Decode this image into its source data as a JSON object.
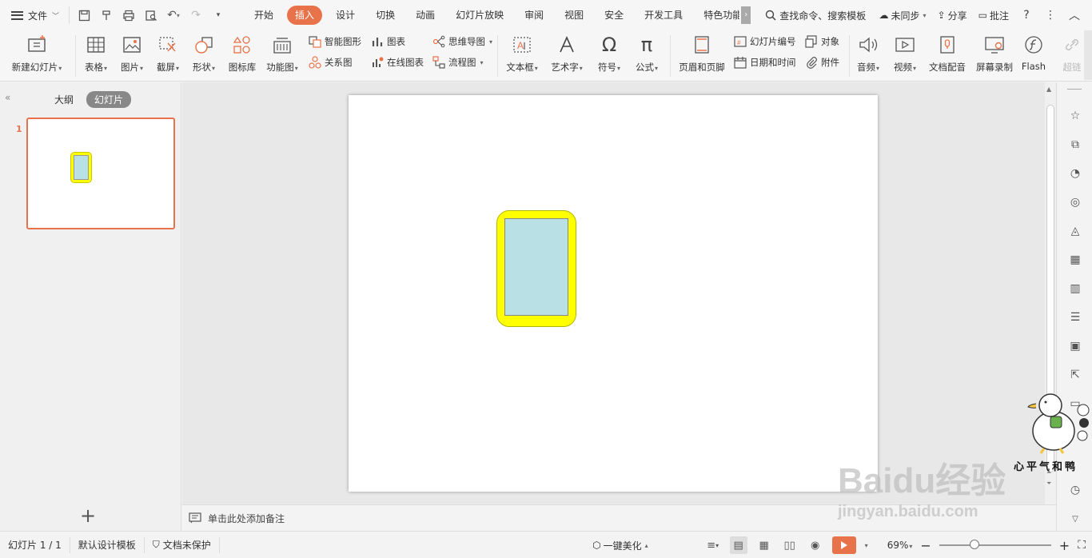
{
  "menubar": {
    "file_label": "文件",
    "tabs": [
      "开始",
      "插入",
      "设计",
      "切换",
      "动画",
      "幻灯片放映",
      "审阅",
      "视图",
      "安全",
      "开发工具",
      "特色功能"
    ],
    "active_tab": "插入",
    "search_label": "查找命令、搜索模板",
    "sync_label": "未同步",
    "share_label": "分享",
    "comment_label": "批注"
  },
  "ribbon": {
    "new_slide": "新建幻灯片",
    "table": "表格",
    "picture": "图片",
    "screenshot": "截屏",
    "shape": "形状",
    "icon_lib": "图标库",
    "function_chart": "功能图",
    "smart_shape": "智能图形",
    "chart": "图表",
    "relation": "关系图",
    "online_chart": "在线图表",
    "mindmap": "思维导图",
    "flowchart": "流程图",
    "textbox": "文本框",
    "wordart": "艺术字",
    "symbol": "符号",
    "formula": "公式",
    "header_footer": "页眉和页脚",
    "slide_number": "幻灯片编号",
    "object": "对象",
    "date_time": "日期和时间",
    "attachment": "附件",
    "audio": "音频",
    "video": "视频",
    "doc_voice": "文档配音",
    "screen_record": "屏幕录制",
    "flash": "Flash",
    "hyperlink": "超链"
  },
  "left_panel": {
    "outline_tab": "大纲",
    "slides_tab": "幻灯片",
    "slide_number": "1",
    "add_slide": "+"
  },
  "notes": {
    "placeholder": "单击此处添加备注"
  },
  "statusbar": {
    "slide_info": "幻灯片 1 / 1",
    "template": "默认设计模板",
    "protection": "文档未保护",
    "beautify": "一键美化",
    "zoom": "69%"
  },
  "watermark": {
    "logo": "Baidu经验",
    "url": "jingyan.baidu.com",
    "mascot_text": "心平气和鸭"
  },
  "colors": {
    "accent": "#e8734a",
    "shape_fill_outer": "#ffff00",
    "shape_fill_inner": "#b9e0e4"
  }
}
